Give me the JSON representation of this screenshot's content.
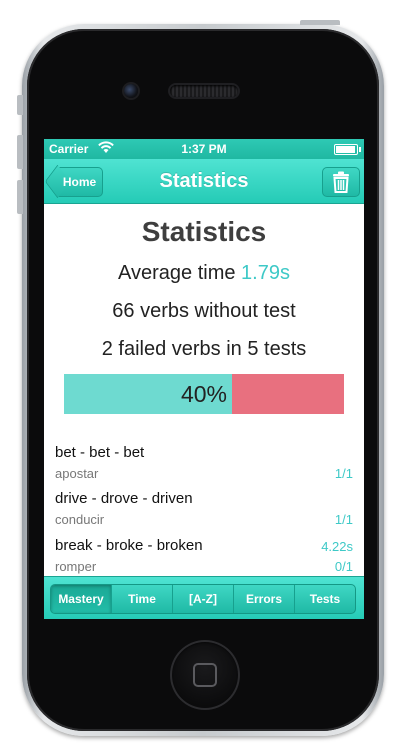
{
  "status_bar": {
    "carrier": "Carrier",
    "time": "1:37 PM"
  },
  "nav": {
    "back_label": "Home",
    "title": "Statistics",
    "trash_icon": "trash-icon"
  },
  "stats": {
    "heading": "Statistics",
    "avg_prefix": "Average time ",
    "avg_value": "1.79s",
    "verbs_without_test": "66 verbs without test",
    "failed_line": "2 failed verbs in 5 tests",
    "progress_label": "40%",
    "progress_fraction": 0.6
  },
  "verbs": [
    {
      "forms": "bet - bet - bet",
      "translation": "apostar",
      "stat1": "",
      "stat2": "1/1"
    },
    {
      "forms": "drive - drove - driven",
      "translation": "conducir",
      "stat1": "",
      "stat2": "1/1"
    },
    {
      "forms": "break - broke - broken",
      "translation": "romper",
      "stat1": "4.22s",
      "stat2": "0/1"
    }
  ],
  "tabs": [
    {
      "label": "Mastery",
      "active": true
    },
    {
      "label": "Time",
      "active": false
    },
    {
      "label": "[A-Z]",
      "active": false
    },
    {
      "label": "Errors",
      "active": false
    },
    {
      "label": "Tests",
      "active": false
    }
  ],
  "colors": {
    "accent": "#3ec9c7",
    "progress_fill": "#6edad0",
    "progress_rest": "#e8707f",
    "bar": "#25cbb6"
  }
}
